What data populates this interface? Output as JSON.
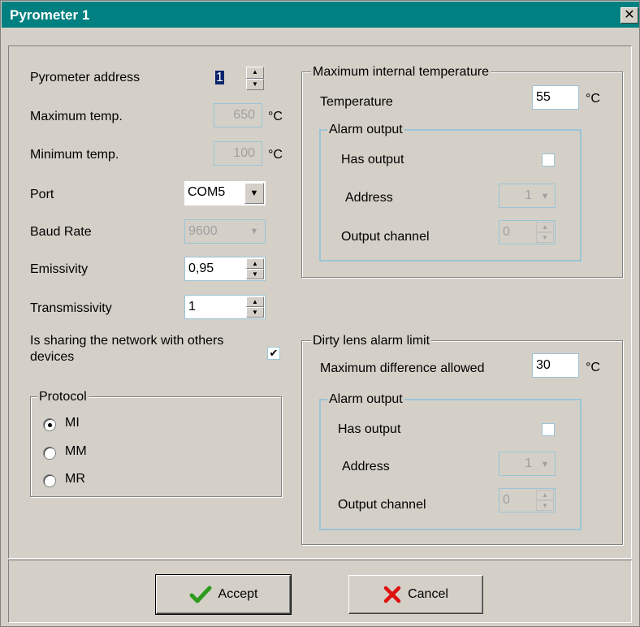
{
  "window": {
    "title": "Pyrometer 1",
    "close_glyph": "✕"
  },
  "left": {
    "address": {
      "label": "Pyrometer address",
      "value": "1"
    },
    "max_temp": {
      "label": "Maximum temp.",
      "value": "650",
      "unit": "°C"
    },
    "min_temp": {
      "label": "Minimum temp.",
      "value": "100",
      "unit": "°C"
    },
    "port": {
      "label": "Port",
      "value": "COM5"
    },
    "baud": {
      "label": "Baud Rate",
      "value": "9600"
    },
    "emissivity": {
      "label": "Emissivity",
      "value": "0,95"
    },
    "transmissivity": {
      "label": "Transmissivity",
      "value": "1"
    },
    "sharing": {
      "label_line1": "Is sharing the network with others",
      "label_line2": "devices",
      "checked": true,
      "check_glyph": "✔"
    },
    "protocol": {
      "title": "Protocol",
      "options": [
        {
          "label": "MI",
          "selected": true
        },
        {
          "label": "MM",
          "selected": false
        },
        {
          "label": "MR",
          "selected": false
        }
      ]
    }
  },
  "internal": {
    "title": "Maximum internal temperature",
    "temperature": {
      "label": "Temperature",
      "value": "55",
      "unit": "°C"
    },
    "alarm": {
      "title": "Alarm output",
      "has_output": {
        "label": "Has output",
        "checked": false
      },
      "address": {
        "label": "Address",
        "value": "1"
      },
      "channel": {
        "label": "Output channel",
        "value": "0"
      }
    }
  },
  "dirty": {
    "title": "Dirty lens alarm limit",
    "max_diff": {
      "label": "Maximum difference allowed",
      "value": "30",
      "unit": "°C"
    },
    "alarm": {
      "title": "Alarm output",
      "has_output": {
        "label": "Has output",
        "checked": false
      },
      "address": {
        "label": "Address",
        "value": "1"
      },
      "channel": {
        "label": "Output channel",
        "value": "0"
      }
    }
  },
  "buttons": {
    "accept": "Accept",
    "cancel": "Cancel"
  },
  "icons": {
    "spin_up": "▲",
    "spin_down": "▼",
    "dropdown": "▼",
    "accept_icon": "check-icon",
    "cancel_icon": "x-icon"
  },
  "colors": {
    "titlebar": "#008080",
    "face": "#d4d0c8",
    "field_border": "#9cc4d6",
    "accept_icon": "#2e9b1e",
    "cancel_icon": "#e01010"
  }
}
